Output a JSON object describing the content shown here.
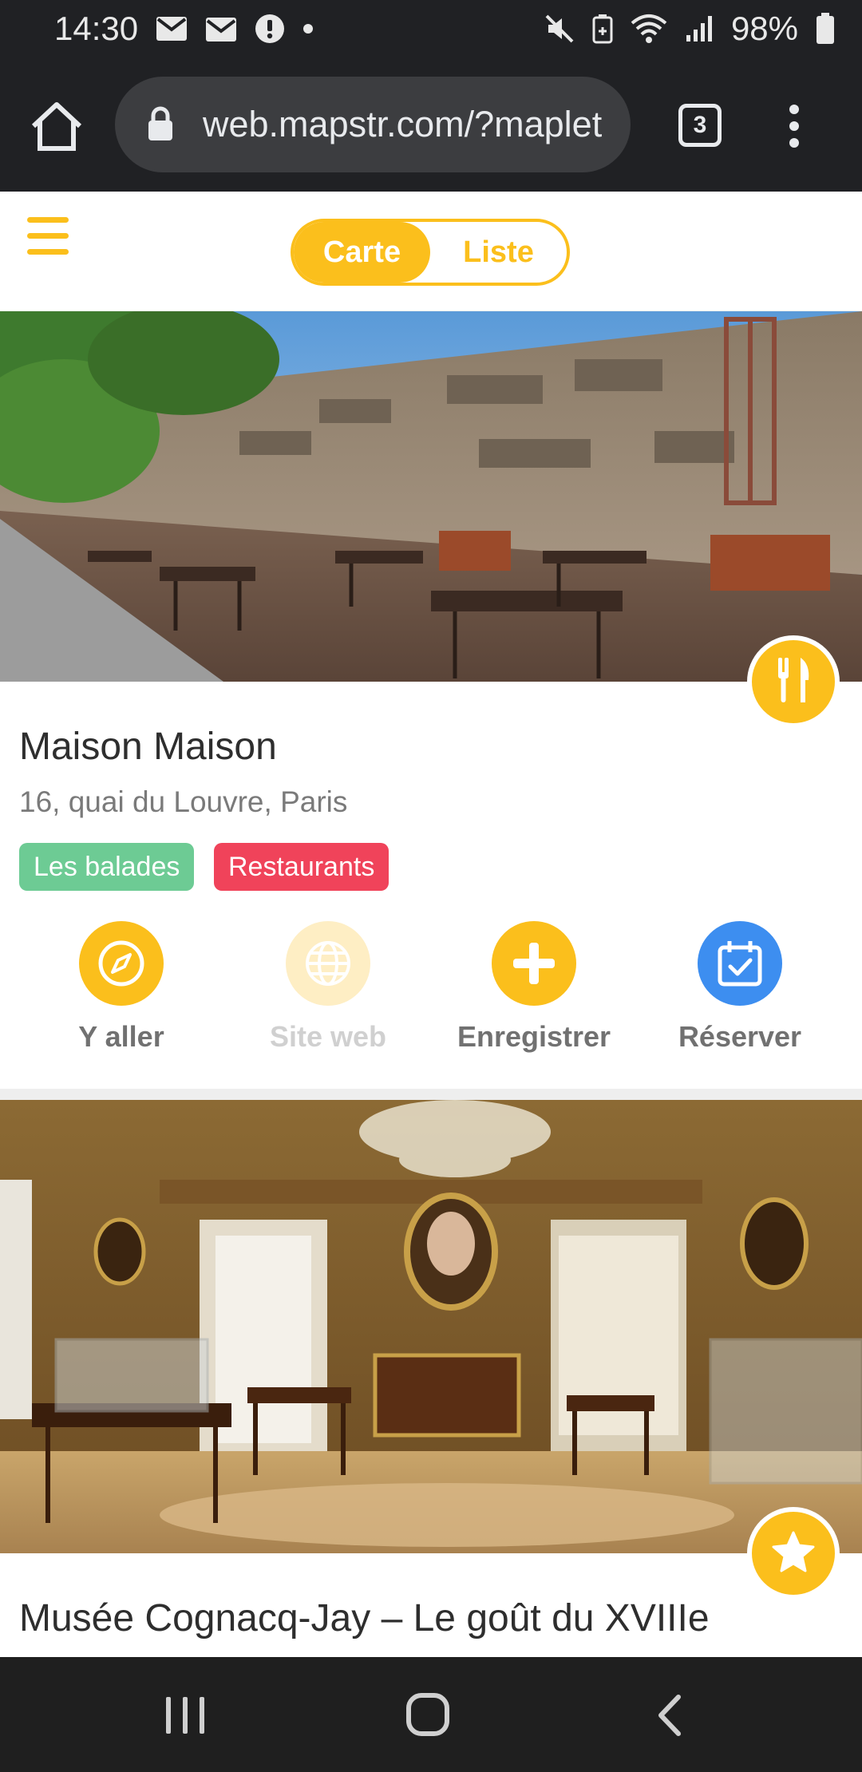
{
  "status_bar": {
    "time": "14:30",
    "battery": "98%",
    "icons": [
      "mail-icon",
      "mail-open-icon",
      "alert-icon",
      "dot-icon",
      "mute-icon",
      "battery-saver-icon",
      "wifi-icon",
      "signal-icon",
      "battery-icon"
    ]
  },
  "browser": {
    "url": "web.mapstr.com/?maplet",
    "tab_count": "3",
    "icons": [
      "home-icon",
      "lock-icon",
      "more-vert-icon"
    ]
  },
  "header": {
    "toggle_map": "Carte",
    "toggle_list": "Liste",
    "active_view": "Liste"
  },
  "places": [
    {
      "title": "Maison Maison",
      "address": "16, quai du Louvre, Paris",
      "category_icon": "fork-knife-icon",
      "tags": [
        {
          "label": "Les balades",
          "color": "#6dcb94"
        },
        {
          "label": "Restaurants",
          "color": "#f0435a"
        }
      ],
      "actions": [
        {
          "label": "Y aller",
          "icon": "compass-icon",
          "enabled": true
        },
        {
          "label": "Site web",
          "icon": "globe-icon",
          "enabled": false
        },
        {
          "label": "Enregistrer",
          "icon": "plus-icon",
          "enabled": true
        },
        {
          "label": "Réserver",
          "icon": "calendar-check-icon",
          "enabled": true
        }
      ]
    },
    {
      "title": "Musée Cognacq-Jay – Le goût du XVIIIe",
      "category_icon": "star-icon"
    }
  ],
  "colors": {
    "accent": "#fbbf1c",
    "reserve_blue": "#3d8ef0",
    "tag_green": "#6dcb94",
    "tag_red": "#f0435a",
    "chrome_dark": "#202124"
  },
  "nav_bar": {
    "icons": [
      "recent-apps-icon",
      "home-nav-icon",
      "back-icon"
    ]
  }
}
